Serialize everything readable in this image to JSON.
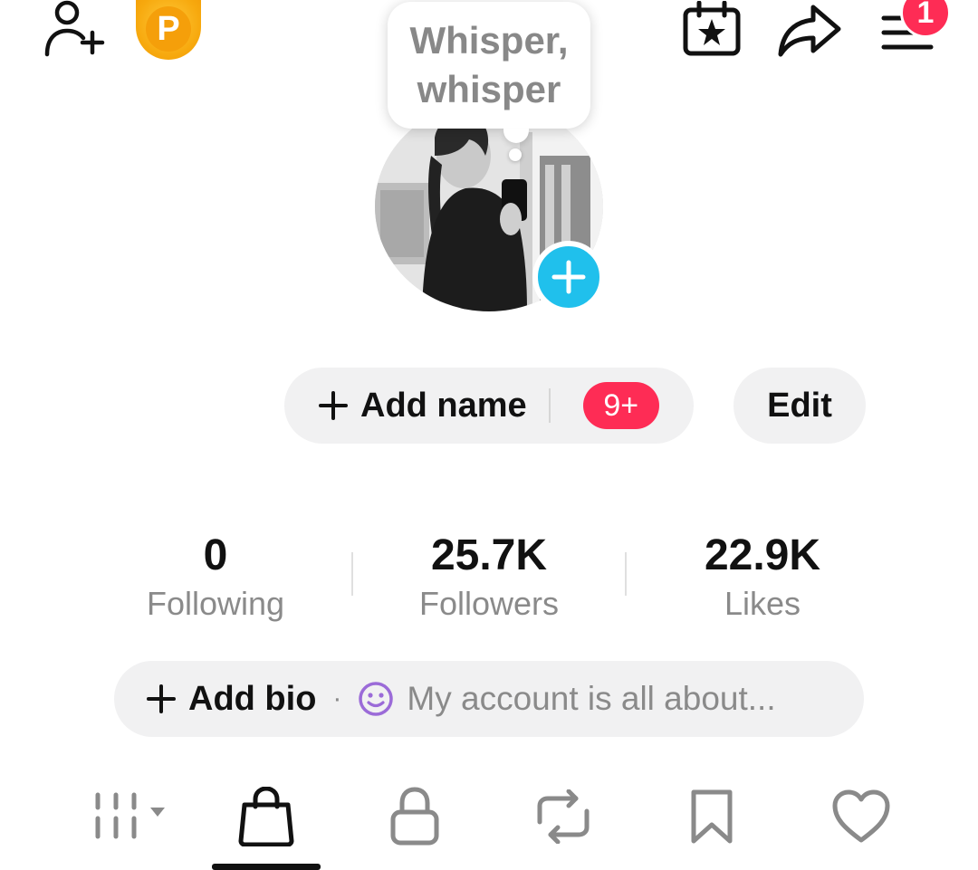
{
  "top_bar": {
    "icons": [
      "add-friend-icon",
      "coin-icon",
      "calendar-star-icon",
      "share-icon",
      "menu-icon"
    ],
    "coin_letter": "P",
    "menu_badge": "1"
  },
  "note": {
    "text": "Whisper, whisper"
  },
  "profile": {
    "add_name_label": "Add name",
    "notification_count": "9+",
    "edit_label": "Edit"
  },
  "stats": [
    {
      "value": "0",
      "label": "Following"
    },
    {
      "value": "25.7K",
      "label": "Followers"
    },
    {
      "value": "22.9K",
      "label": "Likes"
    }
  ],
  "bio": {
    "add_label": "Add bio",
    "separator": "·",
    "placeholder": "My account is all about..."
  },
  "tabs": [
    {
      "icon": "grid-icon",
      "selected": false
    },
    {
      "icon": "shopping-bag-icon",
      "selected": true
    },
    {
      "icon": "lock-icon",
      "selected": false
    },
    {
      "icon": "repost-icon",
      "selected": false
    },
    {
      "icon": "bookmark-icon",
      "selected": false
    },
    {
      "icon": "heart-icon",
      "selected": false
    }
  ],
  "colors": {
    "accent_red": "#fe2c55",
    "accent_cyan": "#20c0ec",
    "coin_gold": "#f7a90e",
    "pill_bg": "#f1f1f2",
    "muted_text": "#8a8a8a",
    "emoji_purple": "#9b6bd8"
  }
}
